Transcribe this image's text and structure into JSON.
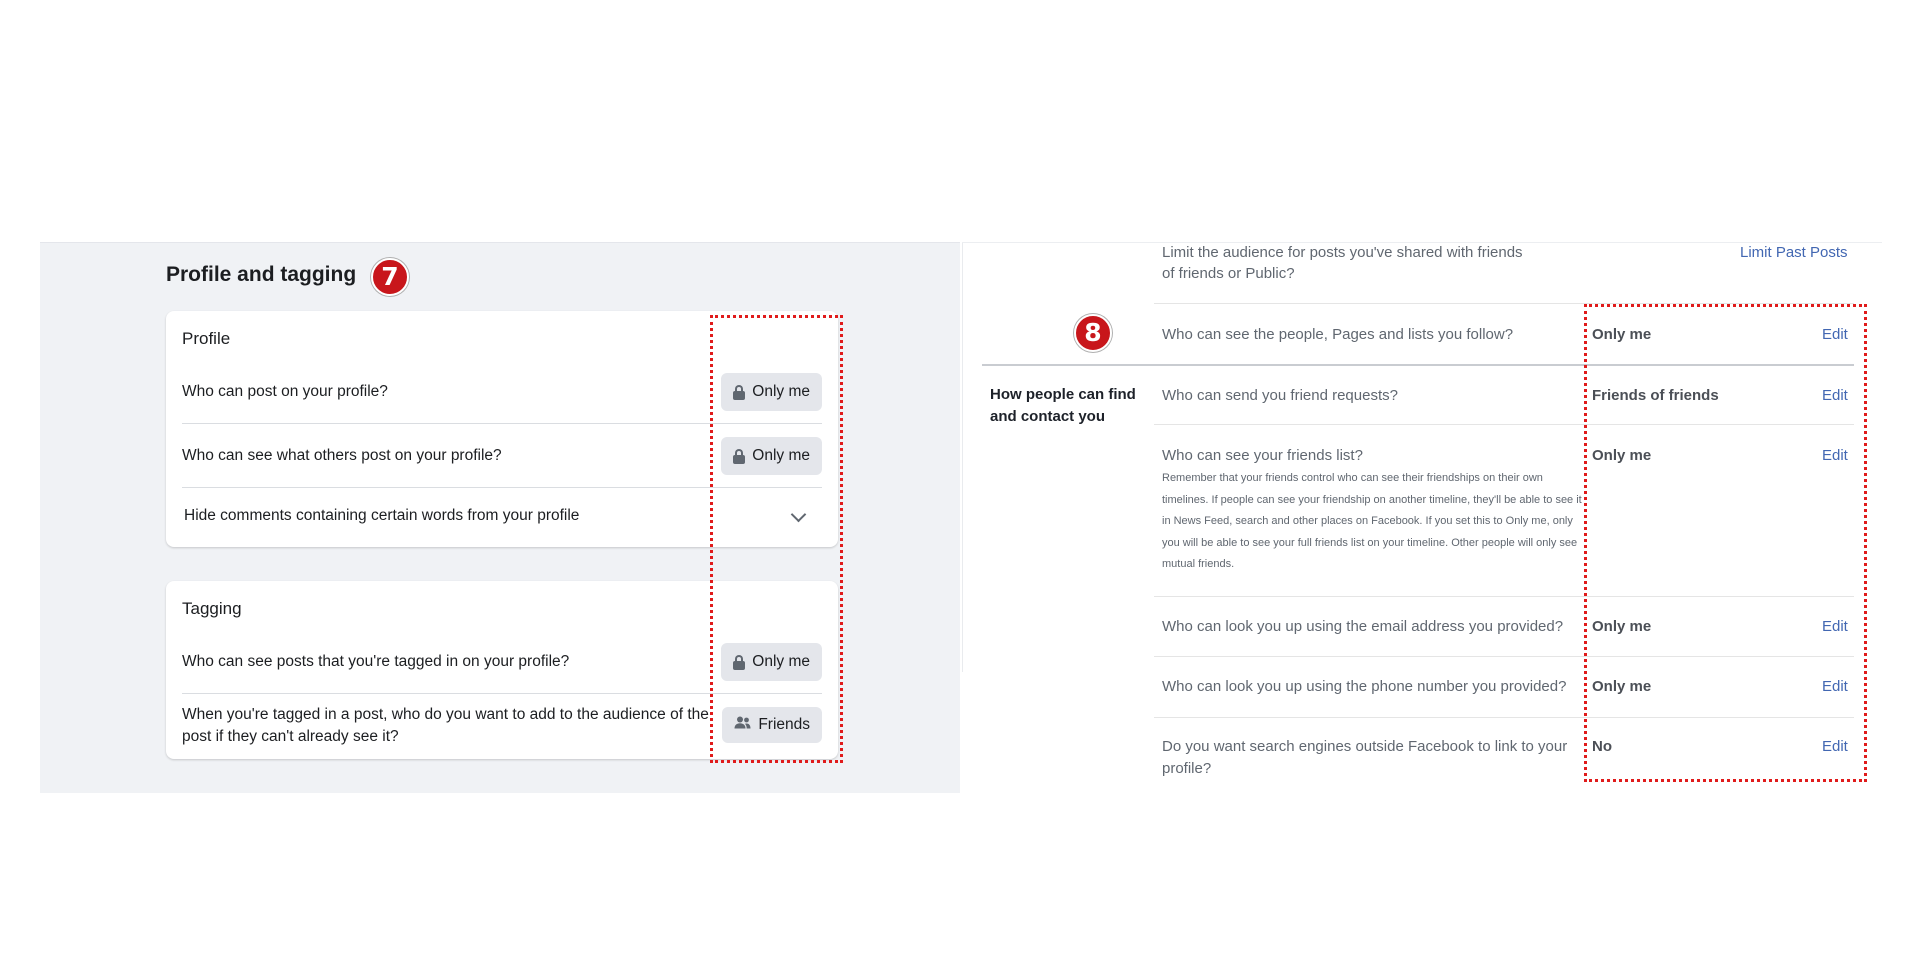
{
  "left": {
    "section_title": "Profile and tagging",
    "marker": "7",
    "profile_card": {
      "heading": "Profile",
      "rows": [
        {
          "question": "Who can post on your profile?",
          "audience": "Only me",
          "icon": "lock-icon"
        },
        {
          "question": "Who can see what others post on your profile?",
          "audience": "Only me",
          "icon": "lock-icon"
        },
        {
          "question": "Hide comments containing certain words from your profile",
          "icon": "chevron-down-icon"
        }
      ]
    },
    "tagging_card": {
      "heading": "Tagging",
      "rows": [
        {
          "question": "Who can see posts that you're tagged in on your profile?",
          "audience": "Only me",
          "icon": "lock-icon"
        },
        {
          "question_line1": "When you're tagged in a post, who do you want to add to the audience of the",
          "question_line2": "post if they can't already see it?",
          "audience": "Friends",
          "icon": "friends-icon"
        }
      ]
    }
  },
  "right": {
    "marker": "8",
    "limit_past": {
      "line1": "Limit the audience for posts you've shared with friends",
      "line2": "of friends or Public?",
      "link": "Limit Past Posts"
    },
    "follow_row": {
      "question": "Who can see the people, Pages and lists you follow?",
      "value": "Only me",
      "edit": "Edit"
    },
    "section_heading_line1": "How people can find",
    "section_heading_line2": "and contact you",
    "rows": [
      {
        "question": "Who can send you friend requests?",
        "value": "Friends of friends",
        "edit": "Edit"
      },
      {
        "question": "Who can see your friends list?",
        "value": "Only me",
        "edit": "Edit",
        "desc": [
          "Remember that your friends control who can see their friendships on their own",
          "timelines. If people can see your friendship on another timeline, they'll be able to see it",
          "in News Feed, search and other places on Facebook. If you set this to Only me, only",
          "you will be able to see your full friends list on your timeline. Other people will only see",
          "mutual friends."
        ]
      },
      {
        "question": "Who can look you up using the email address you provided?",
        "value": "Only me",
        "edit": "Edit"
      },
      {
        "question": "Who can look you up using the phone number you provided?",
        "value": "Only me",
        "edit": "Edit"
      },
      {
        "question_line1": "Do you want search engines outside Facebook to link to your",
        "question_line2": "profile?",
        "value": "No",
        "edit": "Edit"
      }
    ]
  },
  "colors": {
    "highlight": "#e01b1b",
    "marker": "#c8161b",
    "link": "#4267b2"
  }
}
